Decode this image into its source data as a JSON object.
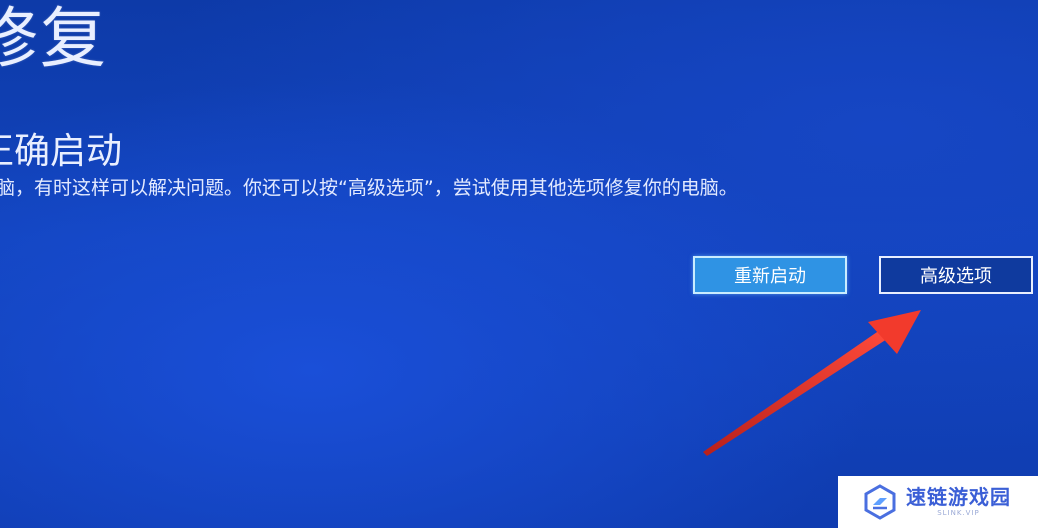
{
  "screen": {
    "title": "修复",
    "subtitle": "正确启动",
    "message": "脑，有时这样可以解决问题。你还可以按“高级选项”，尝试使用其他选项修复你的电脑。"
  },
  "buttons": {
    "restart_label": "重新启动",
    "advanced_label": "高级选项"
  },
  "watermark": {
    "name": "速链游戏园",
    "sub": "SLINK.VIP"
  },
  "colors": {
    "background": "#1244bd",
    "restart_button": "#2f93e4",
    "arrow": "#e0342a",
    "watermark_text": "#3b5fd6"
  },
  "icons": {
    "annotation": "red-arrow-icon",
    "logo": "watermark-logo-icon"
  }
}
